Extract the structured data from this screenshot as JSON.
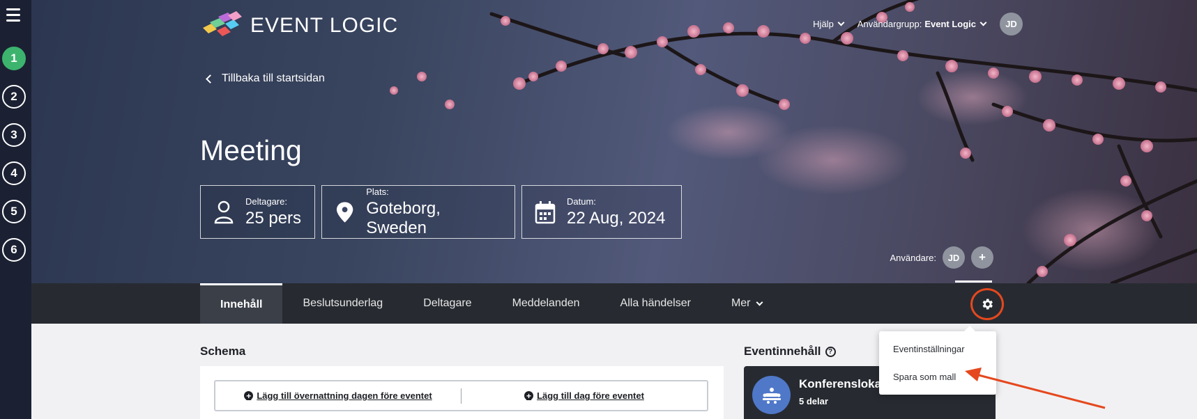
{
  "steps": [
    "1",
    "2",
    "3",
    "4",
    "5",
    "6"
  ],
  "logo": {
    "text": "EVENT LOGIC"
  },
  "topnav": {
    "help": "Hjälp",
    "group_label": "Användargrupp:",
    "group_value": "Event Logic",
    "avatar": "JD"
  },
  "back_link": "Tillbaka till startsidan",
  "event_title": "Meeting",
  "cards": {
    "participants": {
      "label": "Deltagare:",
      "value": "25 pers"
    },
    "place": {
      "label": "Plats:",
      "value": "Goteborg, Sweden"
    },
    "date": {
      "label": "Datum:",
      "value": "22 Aug, 2024"
    }
  },
  "users": {
    "label": "Användare:",
    "avatar": "JD",
    "add": "+"
  },
  "tabs": [
    "Innehåll",
    "Beslutsunderlag",
    "Deltagare",
    "Meddelanden",
    "Alla händelser",
    "Mer"
  ],
  "settings_menu": [
    "Eventinställningar",
    "Spara som mall"
  ],
  "schema": {
    "title": "Schema",
    "add_night": "Lägg till övernattning dagen före eventet",
    "add_day": "Lägg till dag före eventet"
  },
  "event_content": {
    "title": "Eventinnehåll",
    "help": "?",
    "item_name": "Konferenslokal",
    "item_sub": "5 delar"
  },
  "colors": {
    "active_step": "#3cb46e",
    "highlight": "#e5481e",
    "rail": "#1b2133",
    "tabbar": "#272b31"
  }
}
